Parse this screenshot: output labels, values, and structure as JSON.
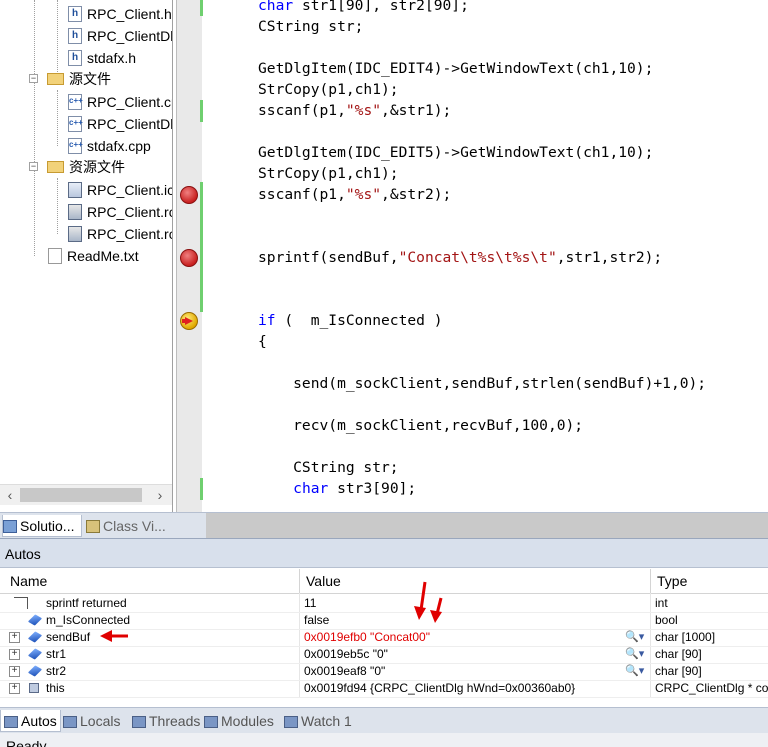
{
  "solution_explorer": {
    "items": [
      {
        "label": "RPC_Client.h",
        "icon": "header-file-icon"
      },
      {
        "label": "RPC_ClientDl",
        "icon": "header-file-icon"
      },
      {
        "label": "stdafx.h",
        "icon": "header-file-icon"
      },
      {
        "label": "源文件",
        "icon": "folder-icon"
      },
      {
        "label": "RPC_Client.cp",
        "icon": "cpp-file-icon"
      },
      {
        "label": "RPC_ClientDl",
        "icon": "cpp-file-icon"
      },
      {
        "label": "stdafx.cpp",
        "icon": "cpp-file-icon"
      },
      {
        "label": "资源文件",
        "icon": "folder-icon"
      },
      {
        "label": "RPC_Client.ic",
        "icon": "icon-file-icon"
      },
      {
        "label": "RPC_Client.rc",
        "icon": "resource-file-icon"
      },
      {
        "label": "RPC_Client.rc",
        "icon": "resource-file-icon"
      },
      {
        "label": "ReadMe.txt",
        "icon": "text-file-icon"
      }
    ],
    "tabs": [
      {
        "label": "Solutio..."
      },
      {
        "label": "Class Vi..."
      }
    ]
  },
  "editor": {
    "lines": [
      [
        {
          "t": "char",
          "k": "kw"
        },
        {
          "t": " str1[90], str2[90];"
        }
      ],
      [
        {
          "t": "CString str;"
        }
      ],
      [],
      [
        {
          "t": "GetDlgItem(IDC_EDIT4)->GetWindowText(ch1,10);"
        }
      ],
      [
        {
          "t": "StrCopy(p1,ch1);"
        }
      ],
      [
        {
          "t": "sscanf(p1,"
        },
        {
          "t": "\"%s\"",
          "k": "str"
        },
        {
          "t": ",&str1);"
        }
      ],
      [],
      [
        {
          "t": "GetDlgItem(IDC_EDIT5)->GetWindowText(ch1,10);"
        }
      ],
      [
        {
          "t": "StrCopy(p1,ch1);"
        }
      ],
      [
        {
          "t": "sscanf(p1,"
        },
        {
          "t": "\"%s\"",
          "k": "str"
        },
        {
          "t": ",&str2);"
        }
      ],
      [],
      [],
      [
        {
          "t": "sprintf(sendBuf,"
        },
        {
          "t": "\"Concat\\t%s\\t%s\\t\"",
          "k": "str"
        },
        {
          "t": ",str1,str2);"
        }
      ],
      [],
      [],
      [
        {
          "t": "if",
          "k": "kw"
        },
        {
          "t": " (  m_IsConnected )"
        }
      ],
      [
        {
          "t": "{"
        }
      ],
      [],
      [
        {
          "t": "    send(m_sockClient,sendBuf,strlen(sendBuf)+1,0);"
        }
      ],
      [],
      [
        {
          "t": "    recv(m_sockClient,recvBuf,100,0);"
        }
      ],
      [],
      [
        {
          "t": "    CString str;"
        }
      ],
      [
        {
          "t": "    "
        },
        {
          "t": "char",
          "k": "kw"
        },
        {
          "t": " str3[90];"
        }
      ]
    ]
  },
  "autos": {
    "title": "Autos",
    "columns": {
      "name": "Name",
      "value": "Value",
      "type": "Type"
    },
    "rows": [
      {
        "name": "sprintf returned",
        "value": "11",
        "type": "int",
        "icon": "return-value-icon"
      },
      {
        "name": "m_IsConnected",
        "value": "false",
        "type": "bool",
        "icon": "variable-icon"
      },
      {
        "name": "sendBuf",
        "value": "0x0019efb0 \"Concat00\"",
        "type": "char [1000]",
        "icon": "variable-icon",
        "changed": true
      },
      {
        "name": "str1",
        "value": "0x0019eb5c \"0\"",
        "type": "char [90]",
        "icon": "variable-icon"
      },
      {
        "name": "str2",
        "value": "0x0019eaf8 \"0\"",
        "type": "char [90]",
        "icon": "variable-icon"
      },
      {
        "name": "this",
        "value": "0x0019fd94 {CRPC_ClientDlg hWnd=0x00360ab0}",
        "type": "CRPC_ClientDlg * co",
        "icon": "object-icon"
      }
    ]
  },
  "bottom_tabs": [
    {
      "label": "Autos",
      "active": true
    },
    {
      "label": "Locals"
    },
    {
      "label": "Threads"
    },
    {
      "label": "Modules"
    },
    {
      "label": "Watch 1"
    }
  ],
  "status": {
    "text": "Ready"
  },
  "colors": {
    "keyword": "#0000ff",
    "string": "#a31515",
    "changed_value": "#e00000",
    "breakpoint": "#c82020",
    "changed_bar": "#6fcf6f"
  }
}
